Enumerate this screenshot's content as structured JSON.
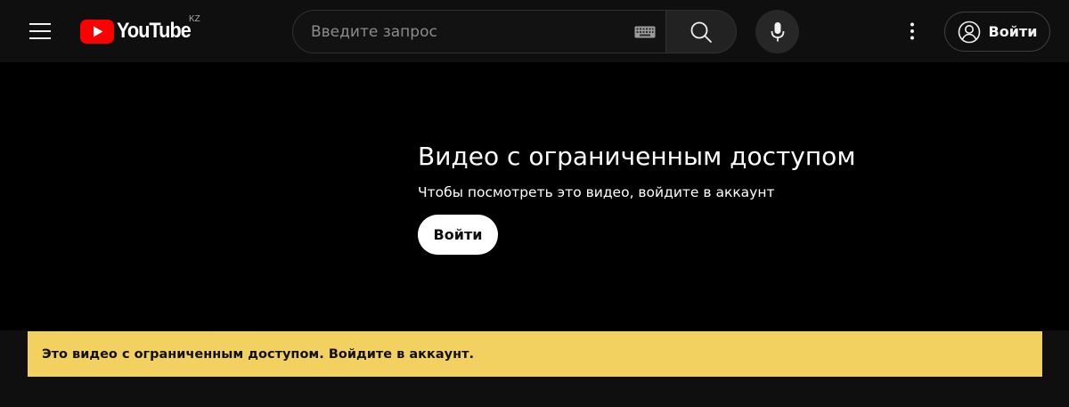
{
  "header": {
    "logo_text": "YouTube",
    "country_code": "KZ",
    "search": {
      "placeholder": "Введите запрос",
      "value": ""
    },
    "signin_label": "Войти",
    "icons": {
      "menu": "hamburger-menu-icon",
      "keyboard": "keyboard-icon",
      "search": "search-icon",
      "mic": "microphone-icon",
      "more": "vertical-dots-icon",
      "account": "account-circle-icon"
    }
  },
  "player": {
    "title": "Видео с ограниченным доступом",
    "subtitle": "Чтобы посмотреть это видео, войдите в аккаунт",
    "signin_label": "Войти"
  },
  "banner": {
    "text": "Это видео с ограниченным доступом. Войдите в аккаунт."
  },
  "colors": {
    "background": "#0f0f0f",
    "player_bg": "#000000",
    "brand_red": "#ff0000",
    "banner_bg": "#f3d160",
    "text_primary": "#f1f1f1"
  }
}
